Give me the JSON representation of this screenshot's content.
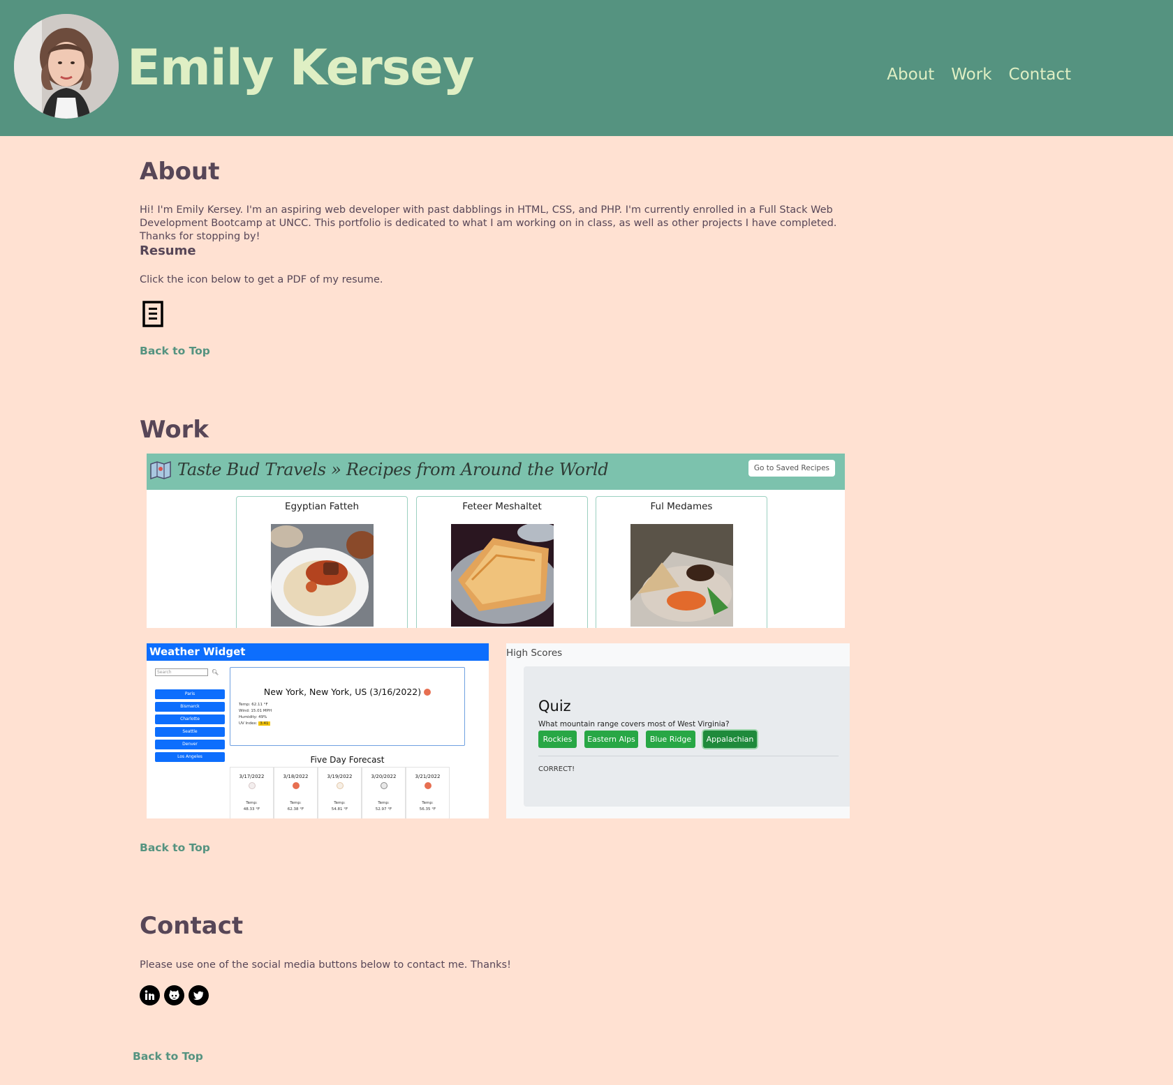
{
  "header": {
    "name": "Emily Kersey",
    "nav": [
      "About",
      "Work",
      "Contact"
    ]
  },
  "about": {
    "heading": "About",
    "intro": "Hi! I'm Emily Kersey. I'm an aspiring web developer with past dabblings in HTML, CSS, and PHP. I'm currently enrolled in a Full Stack Web Development Bootcamp at UNCC. This portfolio is dedicated to what I am working on in class, as well as other projects I have completed. Thanks for stopping by!",
    "resume_heading": "Resume",
    "resume_text": "Click the icon below to get a PDF of my resume.",
    "back_to_top": "Back to Top"
  },
  "work": {
    "heading": "Work",
    "recipes": {
      "title": "Taste Bud Travels » Recipes from Around the World",
      "saved_button": "Go to Saved Recipes",
      "cards": [
        "Egyptian Fatteh",
        "Feteer Meshaltet",
        "Ful Medames"
      ]
    },
    "weather": {
      "title": "Weather Widget",
      "search_placeholder": "Search",
      "cities": [
        "Paris",
        "Bismarck",
        "Charlotte",
        "Seattle",
        "Denver",
        "Los Angeles"
      ],
      "current_title": "New York, New York, US (3/16/2022)",
      "temp": "Temp: 62.11 °F",
      "wind": "Wind: 15.01 MPH",
      "humidity": "Humidity: 49%",
      "uv_label": "UV Index:",
      "uv_value": "3.41",
      "forecast_title": "Five Day Forecast",
      "forecast": [
        {
          "date": "3/17/2022",
          "temp_label": "Temp:",
          "temp": "48.33 °F",
          "icon": "cloud-rain-icon"
        },
        {
          "date": "3/18/2022",
          "temp_label": "Temp:",
          "temp": "62.38 °F",
          "icon": "sun-icon"
        },
        {
          "date": "3/19/2022",
          "temp_label": "Temp:",
          "temp": "54.81 °F",
          "icon": "cloud-sun-icon"
        },
        {
          "date": "3/20/2022",
          "temp_label": "Temp:",
          "temp": "52.97 °F",
          "icon": "cloud-icon"
        },
        {
          "date": "3/21/2022",
          "temp_label": "Temp:",
          "temp": "56.35 °F",
          "icon": "sun-icon"
        }
      ]
    },
    "quiz": {
      "high_scores": "High Scores",
      "title": "Quiz",
      "question": "What mountain range covers most of West Virginia?",
      "answers": [
        "Rockies",
        "Eastern Alps",
        "Blue Ridge",
        "Appalachian"
      ],
      "result": "CORRECT!"
    },
    "back_to_top": "Back to Top"
  },
  "contact": {
    "heading": "Contact",
    "text": "Please use one of the social media buttons below to contact me. Thanks!",
    "socials": [
      "linkedin-icon",
      "github-icon",
      "twitter-icon"
    ],
    "back_to_top": "Back to Top"
  },
  "colors": {
    "header_bg": "#559380",
    "page_bg": "#ffe1d2",
    "accent": "#dfefc4",
    "text": "#574657",
    "link": "#559380"
  }
}
